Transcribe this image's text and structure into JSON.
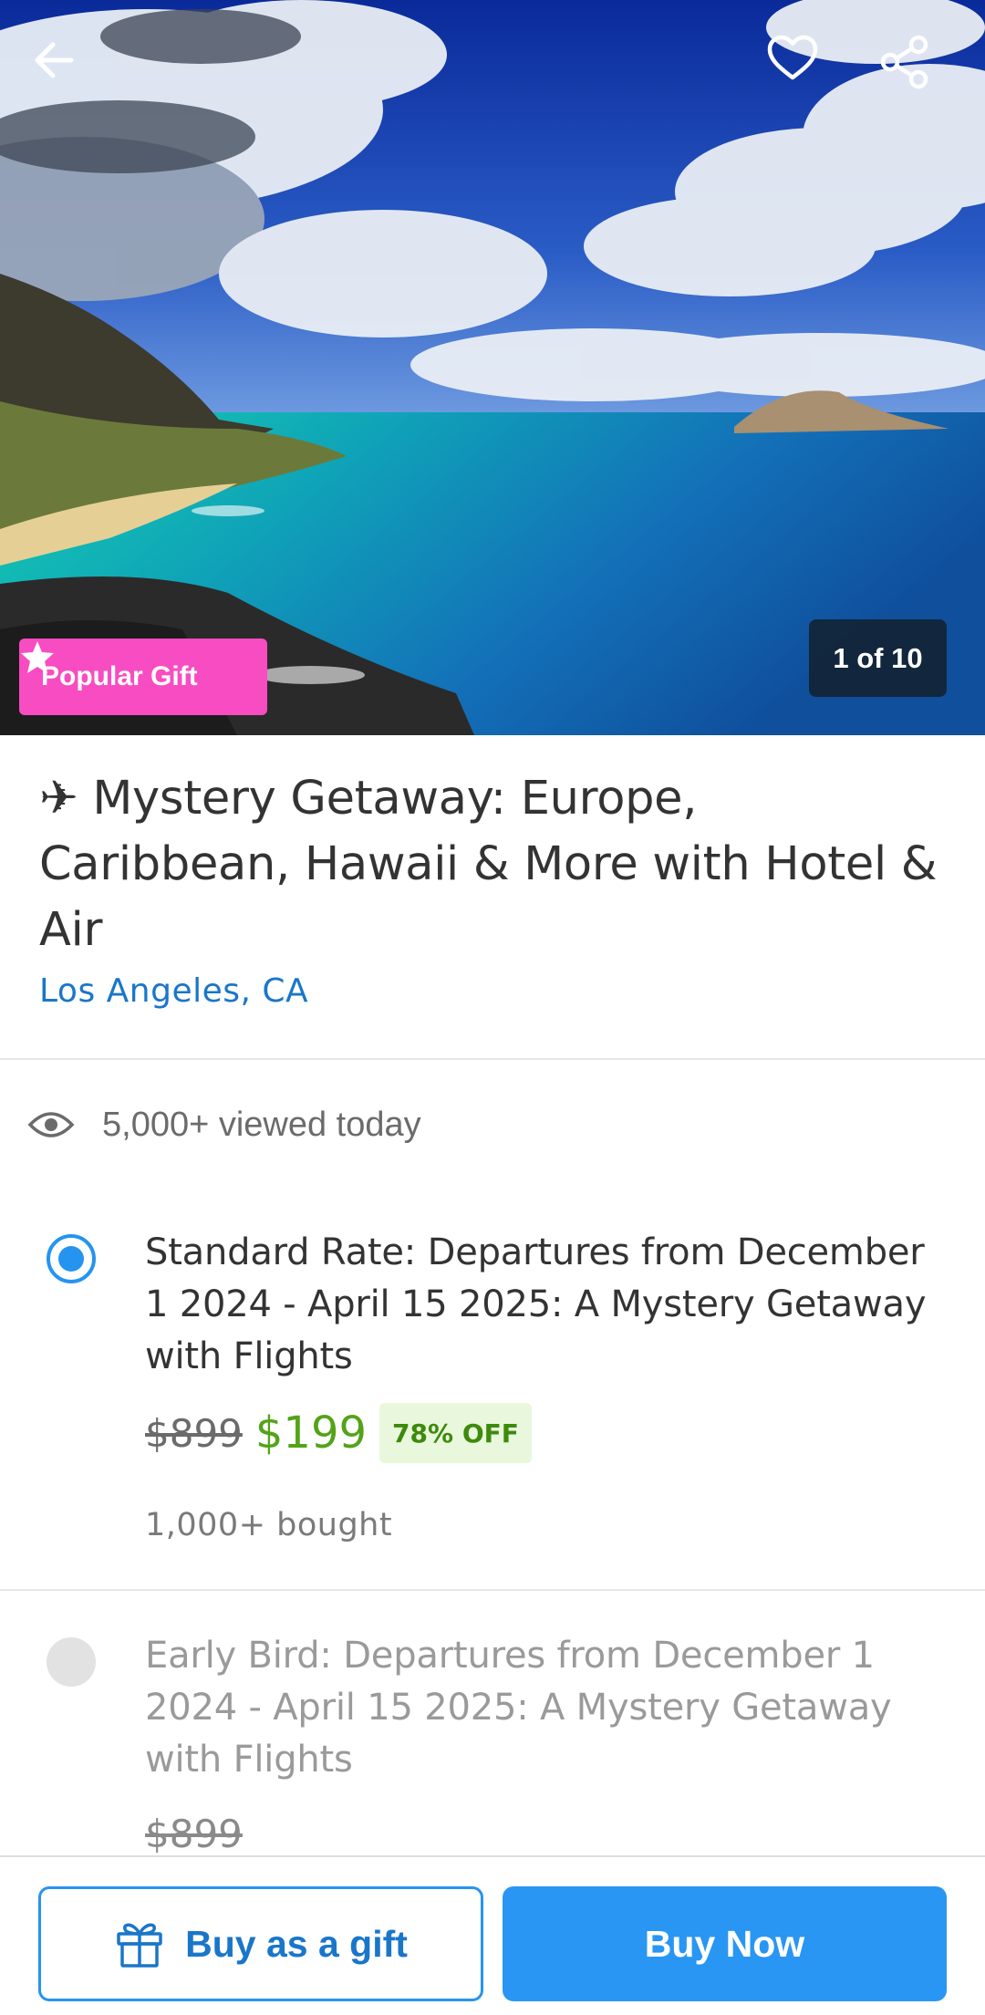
{
  "hero": {
    "badge_label": "Popular Gift",
    "photo_counter": "1 of 10",
    "icons": {
      "back": "arrow-left-icon",
      "favorite": "heart-icon",
      "share": "share-icon",
      "badge": "star-icon"
    }
  },
  "deal": {
    "title": "✈ Mystery Getaway: Europe, Caribbean, Hawaii & More with Hotel & Air",
    "location": "Los Angeles, CA",
    "viewed_text": "5,000+ viewed today"
  },
  "options": [
    {
      "title": "Standard Rate: Departures from December 1 2024 - April 15 2025: A Mystery Getaway with Flights",
      "original_price": "$899",
      "price": "$199",
      "discount": "78% OFF",
      "bought": "1,000+ bought",
      "selected": true
    },
    {
      "title": "Early Bird: Departures from December 1 2024 - April 15 2025: A Mystery Getaway with Flights",
      "original_price": "$899",
      "selected": false
    }
  ],
  "actions": {
    "gift_label": "Buy as a gift",
    "buy_label": "Buy Now"
  },
  "colors": {
    "accent_blue": "#2594f0",
    "link_blue": "#1a76c9",
    "badge_pink": "#f84cc2",
    "price_green": "#53a318",
    "off_bg": "#e9f7dc"
  }
}
